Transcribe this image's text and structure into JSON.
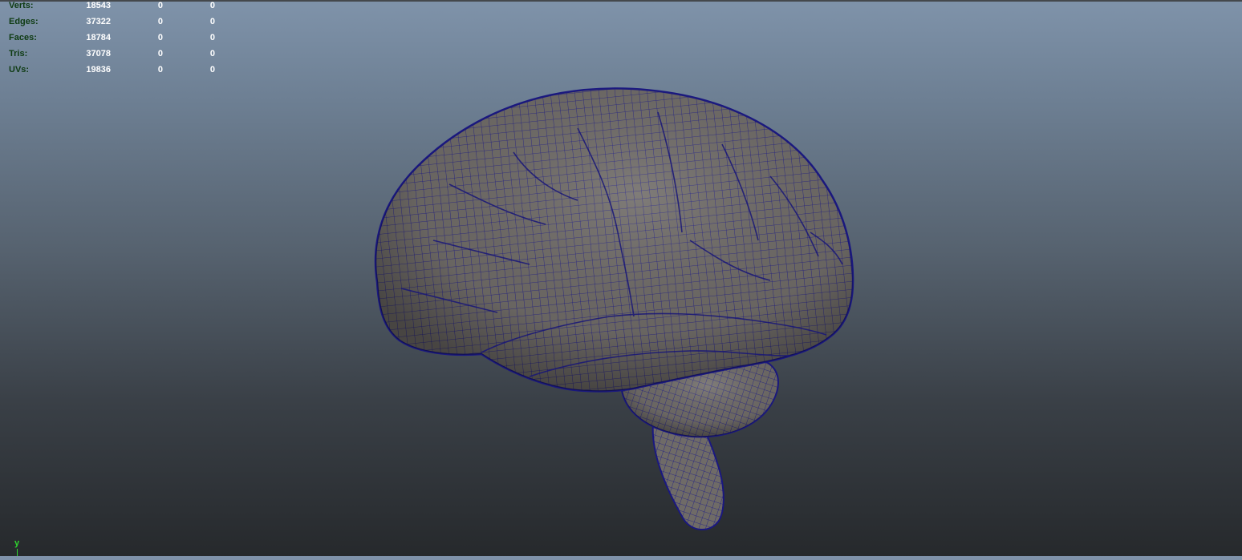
{
  "heads_up_display": {
    "rows": [
      {
        "label": "Verts:",
        "c1": "18543",
        "c2": "0",
        "c3": "0"
      },
      {
        "label": "Edges:",
        "c1": "37322",
        "c2": "0",
        "c3": "0"
      },
      {
        "label": "Faces:",
        "c1": "18784",
        "c2": "0",
        "c3": "0"
      },
      {
        "label": "Tris:",
        "c1": "37078",
        "c2": "0",
        "c3": "0"
      },
      {
        "label": "UVs:",
        "c1": "19836",
        "c2": "0",
        "c3": "0"
      }
    ]
  },
  "view_axis": {
    "label": "y"
  },
  "colors": {
    "hud_label": "#0e3b12",
    "hud_value": "#ffffff",
    "wireframe": "#1c1a86",
    "mesh_fill": "#6e6a66",
    "axis": "#2fd52f"
  },
  "icons": {
    "model": "brain-mesh-icon",
    "axis": "axis-gizmo-icon"
  }
}
